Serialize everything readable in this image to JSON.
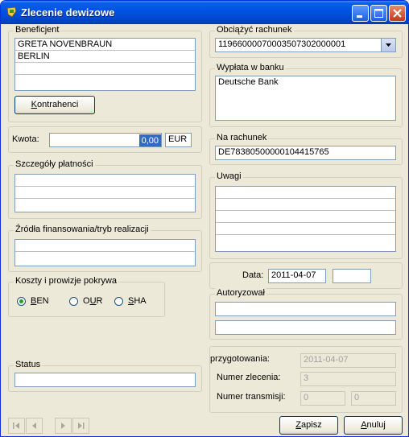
{
  "window": {
    "title": "Zlecenie dewizowe"
  },
  "beneficjent": {
    "title": "Beneficjent",
    "lines": [
      "GRETA NOVENBRAUN",
      "BERLIN",
      "",
      ""
    ],
    "button_label_u": "K",
    "button_label_rest": "ontrahenci"
  },
  "obciazyc": {
    "title": "Obciążyć rachunek",
    "value": "11966000070003507302000001"
  },
  "wyplata": {
    "title": "Wypłata w banku",
    "lines": [
      "Deutsche Bank",
      "",
      ""
    ]
  },
  "kwota": {
    "label": "Kwota:",
    "value": "0,00",
    "currency": "EUR"
  },
  "na_rachunek": {
    "title": "Na rachunek",
    "value": "DE78380500000104415765"
  },
  "szczegoly": {
    "title": "Szczegóły płatności"
  },
  "uwagi": {
    "title": "Uwagi"
  },
  "zrodla": {
    "title": "Źródła finansowania/tryb realizacji"
  },
  "koszty": {
    "title": "Koszty i prowizje pokrywa",
    "options": [
      "BEN",
      "OUR",
      "SHA"
    ],
    "selected": "BEN"
  },
  "data": {
    "label": "Data:",
    "value": "2011-04-07"
  },
  "autoryzowal": {
    "title": "Autoryzował"
  },
  "status": {
    "title": "Status"
  },
  "info": {
    "przygotowania_label": "przygotowania:",
    "przygotowania_value": "2011-04-07",
    "numer_zlecenia_label": "Numer zlecenia:",
    "numer_zlecenia_value": "3",
    "numer_transmisji_label": "Numer transmisji:",
    "numer_transmisji_a": "0",
    "numer_transmisji_b": "0"
  },
  "buttons": {
    "zapisz_u": "Z",
    "zapisz_rest": "apisz",
    "anuluj_u": "A",
    "anuluj_rest": "nuluj"
  }
}
